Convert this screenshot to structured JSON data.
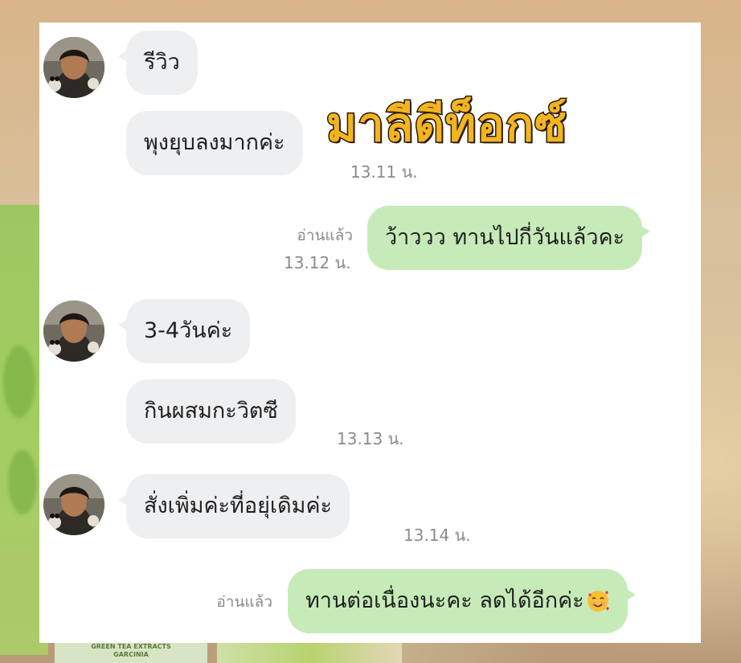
{
  "overlay": {
    "brand_text": "มาลีดีท็อกซ์"
  },
  "background": {
    "package_label": "GREEN TEA EXTRACTS\nGARCINIA"
  },
  "messages": [
    {
      "side": "in",
      "text": "รีวิว"
    },
    {
      "side": "in",
      "text": "พุงยุบลงมากค่ะ",
      "time": "13.11 น."
    },
    {
      "side": "out",
      "text": "ว้าววว ทานไปกี่วันแล้วคะ",
      "read": "อ่านแล้ว",
      "time": "13.12 น."
    },
    {
      "side": "in",
      "text": "3-4วันค่ะ"
    },
    {
      "side": "in",
      "text": "กินผสมกะวิตซี",
      "time": "13.13 น."
    },
    {
      "side": "in",
      "text": "สั่งเพิ่มค่ะที่อยุ่เดิมค่ะ",
      "time": "13.14 น."
    },
    {
      "side": "out",
      "text": "ทานต่อเนื่องนะคะ ลดได้อีกค่ะ",
      "emoji": "smiling-face-with-hearts",
      "read": "อ่านแล้ว"
    }
  ],
  "colors": {
    "incoming_bubble": "#eeeff1",
    "outgoing_bubble": "#c6ebb8",
    "brand_fill": "#f2b51f",
    "brand_outline": "#2a1a08",
    "meta_text": "#8b8b8b"
  },
  "icons": {
    "avatar": "user-avatar-photo",
    "emoji": "smiling-face-with-hearts"
  }
}
